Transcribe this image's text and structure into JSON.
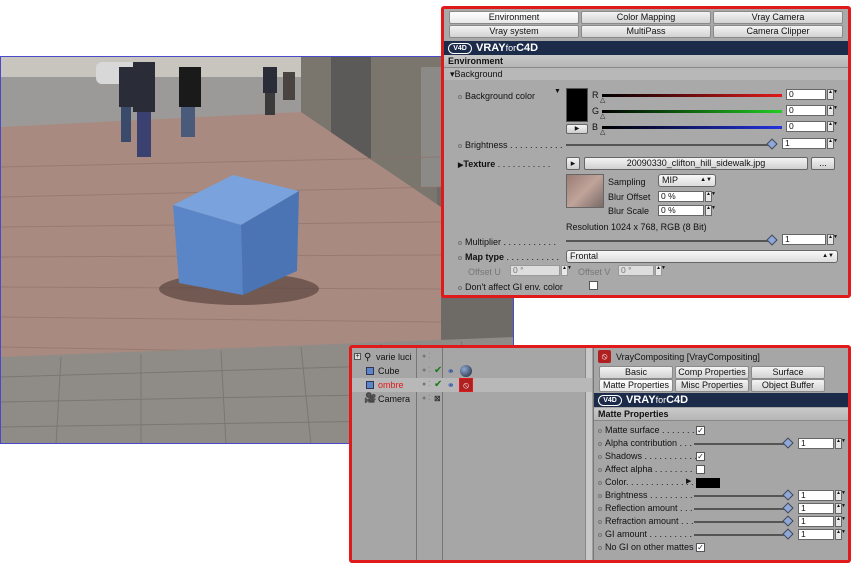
{
  "env_panel": {
    "tabs_row1": [
      "Environment",
      "Color Mapping",
      "Vray Camera"
    ],
    "tabs_row2": [
      "Vray system",
      "MultiPass",
      "Camera Clipper"
    ],
    "brand_bold": "VRAY",
    "brand_for": "for",
    "brand_c4d": "C4D",
    "section": "Environment",
    "subsection": "Background",
    "background_color_label": "Background color",
    "r_label": "R",
    "g_label": "G",
    "b_label": "B",
    "r_value": "0",
    "g_value": "0",
    "b_value": "0",
    "brightness_label": "Brightness . . . . . . . . . . .",
    "brightness_value": "1",
    "texture_label": "Texture",
    "texture_dots": ". . . . . . . . . . .",
    "texture_file": "20090330_clifton_hill_sidewalk.jpg",
    "more_button": "...",
    "sampling_label": "Sampling",
    "sampling_value": "MIP",
    "blur_offset_label": "Blur Offset",
    "blur_offset_value": "0 %",
    "blur_scale_label": "Blur Scale",
    "blur_scale_value": "0 %",
    "resolution": "Resolution 1024 x 768, RGB (8 Bit)",
    "multiplier_label": "Multiplier . . . . . . . . . . .",
    "multiplier_value": "1",
    "map_type_label": "Map type",
    "map_type_dots": ". . . . . . . . . . .",
    "map_type_value": "Frontal",
    "offset_u_label": "Offset U",
    "offset_u_value": "0 °",
    "offset_v_label": "Offset V",
    "offset_v_value": "0 °",
    "gi_env_label": "Don't affect GI env. color"
  },
  "object_manager": {
    "objects": [
      {
        "name": "varie luci",
        "color": "#111111"
      },
      {
        "name": "Cube",
        "color": "#111111"
      },
      {
        "name": "ombre",
        "color": "#e01a1a"
      },
      {
        "name": "Camera",
        "color": "#111111"
      }
    ]
  },
  "comp_panel": {
    "title": "VrayCompositing [VrayCompositing]",
    "tabs_row1": [
      "Basic",
      "Comp Properties",
      "Surface Properties"
    ],
    "tabs_row2": [
      "Matte Properties",
      "Misc Properties",
      "Object Buffer"
    ],
    "brand_bold": "VRAY",
    "brand_for": "for",
    "brand_c4d": "C4D",
    "section": "Matte Properties",
    "rows": [
      {
        "label": "Matte surface . . . . . . .",
        "kind": "check",
        "checked": true
      },
      {
        "label": "Alpha contribution . . .",
        "kind": "slider",
        "value": "1"
      },
      {
        "label": "Shadows . . . . . . . . . . .",
        "kind": "check",
        "checked": true
      },
      {
        "label": "Affect alpha . . . . . . . .",
        "kind": "check",
        "checked": false
      },
      {
        "label": "Color. . . . . . . . . . . . . .",
        "kind": "color"
      },
      {
        "label": "Brightness . . . . . . . . .",
        "kind": "slider",
        "value": "1"
      },
      {
        "label": "Reflection amount . . .",
        "kind": "slider",
        "value": "1"
      },
      {
        "label": "Refraction amount . . .",
        "kind": "slider",
        "value": "1"
      },
      {
        "label": "GI amount . . . . . . . . .",
        "kind": "slider",
        "value": "1"
      },
      {
        "label": "No GI on other mattes",
        "kind": "check",
        "checked": true
      }
    ]
  },
  "colors": {
    "highlight_border": "#e01a1a",
    "cube": "#5a86c8",
    "banner": "#1d2b4a"
  }
}
